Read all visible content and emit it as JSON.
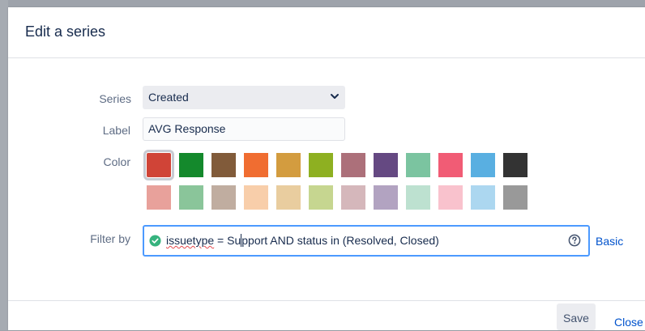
{
  "dialog": {
    "title": "Edit a series"
  },
  "form": {
    "series_label": "Series",
    "series_value": "Created",
    "label_label": "Label",
    "label_value": "AVG Response",
    "color_label": "Color",
    "filter_label": "Filter by",
    "filter_query_field": "issuetype",
    "filter_query_before_caret": " = Su",
    "filter_query_after_caret": "pport AND status in (Resolved, Closed)",
    "basic_link": "Basic"
  },
  "colors": {
    "selected": "#d04437",
    "row1": [
      "#d04437",
      "#14892c",
      "#815b3a",
      "#f06d31",
      "#d39c3f",
      "#8eb021",
      "#ac707a",
      "#654982",
      "#7bc4a0",
      "#f15c75",
      "#59afe1",
      "#333333"
    ],
    "row2": [
      "#e8a19b",
      "#8ac59a",
      "#c0ada0",
      "#f8ceaa",
      "#e9cd9f",
      "#c6d690",
      "#d5b7bb",
      "#b2a3c1",
      "#bde1d0",
      "#f9c2cd",
      "#acd7f0",
      "#999999"
    ]
  },
  "icons": {
    "series_dropdown": "chevron-down-icon",
    "query_status": "check-circle-icon",
    "query_help": "question-circle-icon"
  },
  "footer": {
    "save_label": "Save",
    "close_label": "Close"
  }
}
